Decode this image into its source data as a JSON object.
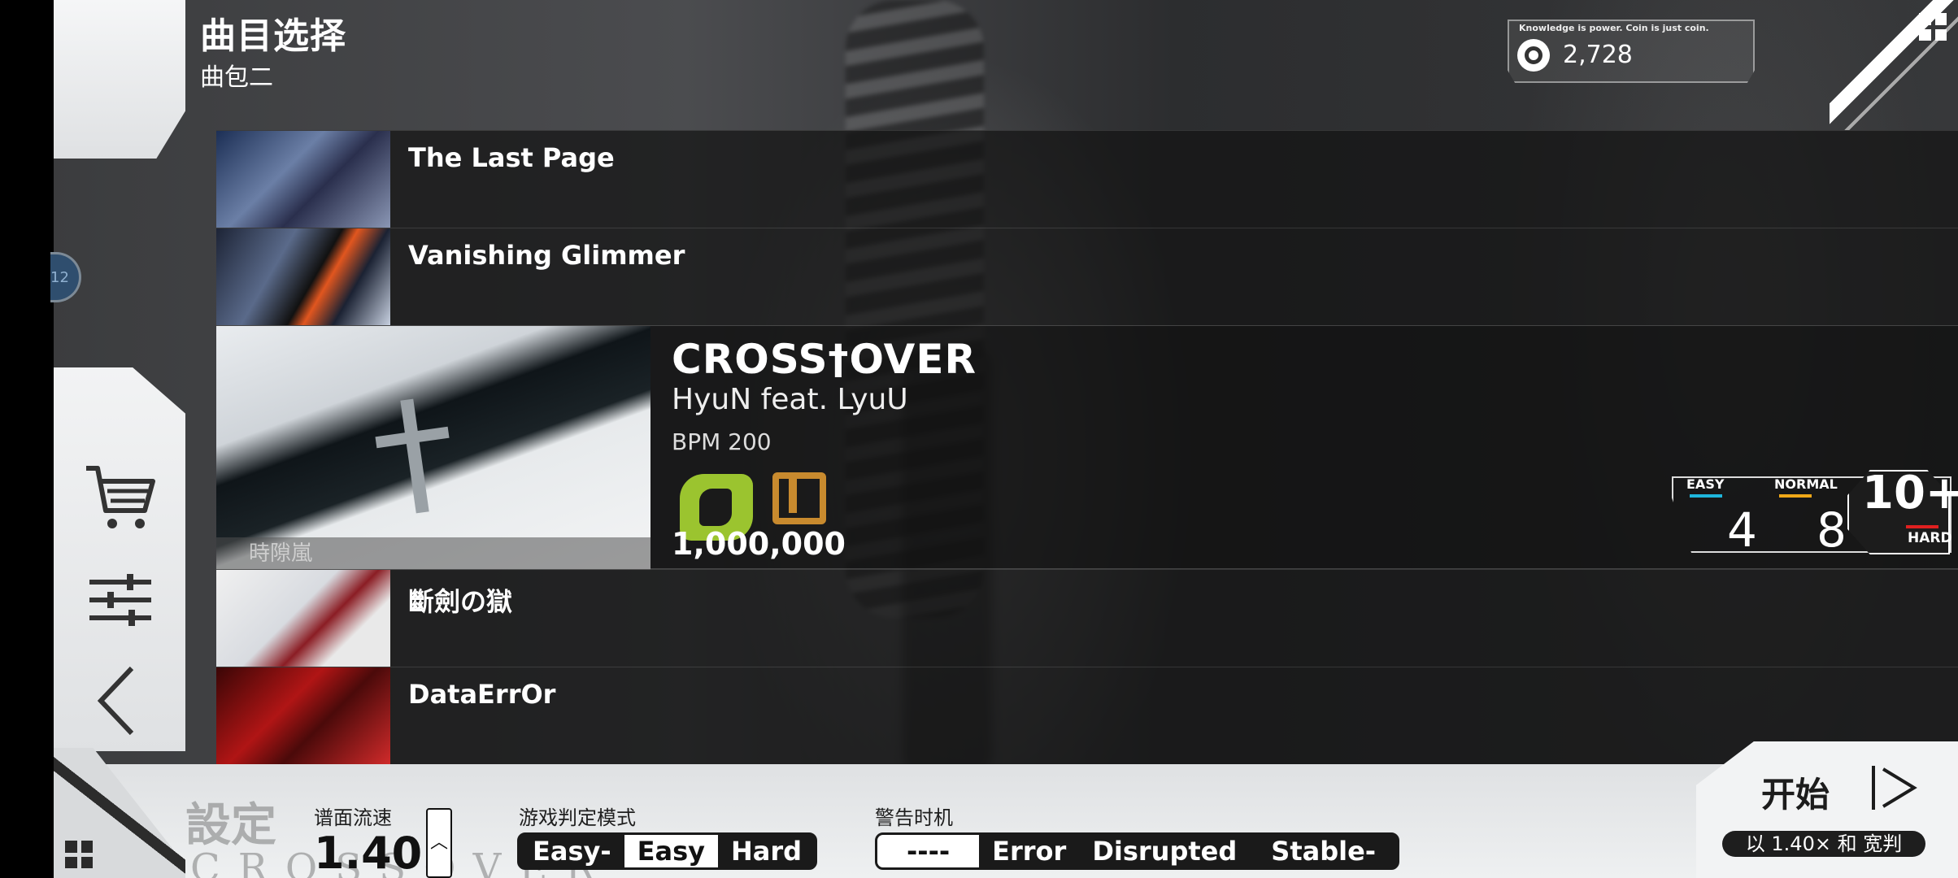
{
  "header": {
    "title": "曲目选择",
    "subtitle": "曲包二"
  },
  "coins": {
    "motto": "Knowledge is power. Coin is just coin.",
    "amount": "2,728"
  },
  "songs": [
    {
      "name": "The Last Page"
    },
    {
      "name": "Vanishing Glimmer"
    },
    {
      "name": "斷劍の獄"
    },
    {
      "name": "DataErrOr"
    }
  ],
  "selected": {
    "title": "CROSS†OVER",
    "artist": "HyuN feat. LyuU",
    "bpm": "BPM 200",
    "score": "1,000,000",
    "jacket_credit": "時隙嵐",
    "difficulties": {
      "easy": {
        "label": "EASY",
        "level": "4",
        "color": "#1fb6dc"
      },
      "normal": {
        "label": "NORMAL",
        "level": "8",
        "color": "#f0a818"
      },
      "hard": {
        "label": "HARD",
        "level": "10+",
        "color": "#e02020"
      }
    }
  },
  "settings": {
    "bg_label": "設定",
    "bg_song": "CROSSOVER",
    "speed_label": "谱面流速",
    "speed_value": "1.40",
    "judge_label": "游戏判定模式",
    "judge_options": [
      "Easy-",
      "Easy",
      "Hard"
    ],
    "judge_selected": "Easy",
    "warn_label": "警告时机",
    "warn_options": [
      "----",
      "Error",
      "Disrupted",
      "Stable-"
    ],
    "warn_selected": "----"
  },
  "start": {
    "label": "开始",
    "sub": "以 1.40× 和 宽判"
  }
}
